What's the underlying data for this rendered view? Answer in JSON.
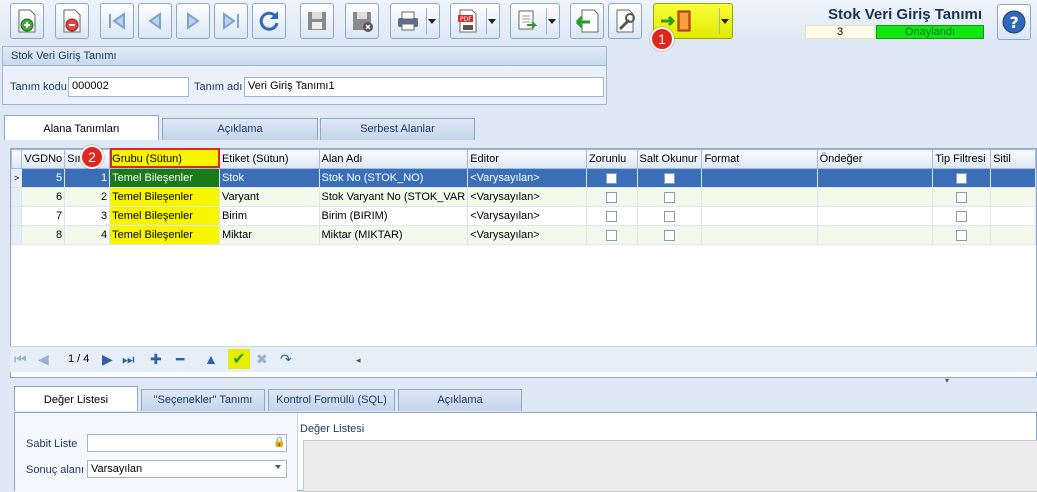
{
  "toolbar": {
    "buttons": [
      {
        "name": "new-icon"
      },
      {
        "name": "delete-icon"
      },
      {
        "name": "first-icon"
      },
      {
        "name": "prev-icon"
      },
      {
        "name": "next-icon"
      },
      {
        "name": "last-icon"
      },
      {
        "name": "refresh-icon"
      },
      {
        "name": "save-icon"
      },
      {
        "name": "cancel-save-icon"
      },
      {
        "name": "print-icon"
      },
      {
        "name": "pdf-icon"
      },
      {
        "name": "export-icon"
      },
      {
        "name": "back-icon"
      },
      {
        "name": "tools-icon"
      },
      {
        "name": "exit-icon"
      }
    ],
    "markers": [
      "1",
      "2"
    ]
  },
  "header": {
    "title": "Stok Veri Giriş Tanımı",
    "record_number": "3",
    "status": "Onaylandı",
    "status_color": "#11e611"
  },
  "definition": {
    "group_title": "Stok Veri Giriş Tanımı",
    "code_label": "Tanım kodu",
    "code_value": "000002",
    "name_label": "Tanım adı",
    "name_value": "Veri Giriş Tanımı1"
  },
  "tabs": [
    "Alana Tanımları",
    "Açıklama",
    "Serbest Alanlar"
  ],
  "grid": {
    "columns": [
      "VGDNo",
      "Sıra",
      "Grubu (Sütun)",
      "Etiket (Sütun)",
      "Alan Adı",
      "Editor",
      "Zorunlu",
      "Salt Okunur",
      "Format",
      "Öndeğer",
      "Tip Filtresi",
      "Sitil"
    ],
    "rows": [
      {
        "vgdno": "5",
        "sira": "1",
        "grubu": "Temel Bileşenler",
        "etiket": "Stok",
        "alan": "Stok No (STOK_NO)",
        "editor": "<Varysayılan>"
      },
      {
        "vgdno": "6",
        "sira": "2",
        "grubu": "Temel Bileşenler",
        "etiket": "Varyant",
        "alan": "Stok Varyant No (STOK_VAR",
        "editor": "<Varysayılan>"
      },
      {
        "vgdno": "7",
        "sira": "3",
        "grubu": "Temel Bileşenler",
        "etiket": "Birim",
        "alan": "Birim (BIRIM)",
        "editor": "<Varysayılan>"
      },
      {
        "vgdno": "8",
        "sira": "4",
        "grubu": "Temel Bileşenler",
        "etiket": "Miktar",
        "alan": "Miktar (MIKTAR)",
        "editor": "<Varysayılan>"
      }
    ],
    "selected_row": 0,
    "group_highlight_color": "#f7f600"
  },
  "navigator": {
    "page": "1 / 4"
  },
  "bottom_tabs": [
    "Değer Listesi",
    "\"Seçenekler\" Tanımı",
    "Kontrol Formülü (SQL)",
    "Açıklama"
  ],
  "bottom": {
    "fixed_list_label": "Sabit Liste",
    "fixed_list_value": "",
    "result_label": "Sonuç alanı",
    "result_value": "Varsayılan",
    "value_list_title": "Değer Listesi"
  }
}
